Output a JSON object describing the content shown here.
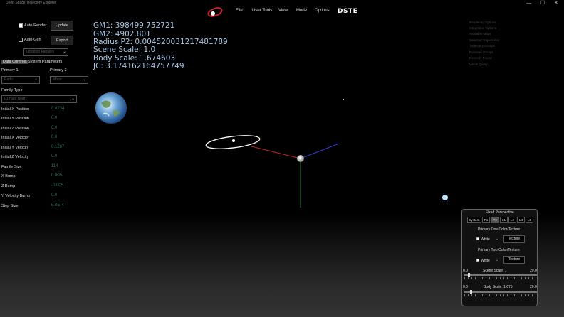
{
  "window": {
    "title": "Deep Space Trajectory Explorer",
    "minimize": "—",
    "maximize": "☐",
    "close": "✕"
  },
  "menu": {
    "items": [
      "File",
      "User Tools",
      "View",
      "Mode",
      "Options"
    ],
    "brand": "DSTE"
  },
  "left_panel": {
    "auto_render": {
      "label": "Auto-Render",
      "checked": true
    },
    "update_button": "Update",
    "auto_gen": {
      "label": "Auto-Gen",
      "checked": false
    },
    "export_button": "Export",
    "libration_select": "Libration Families",
    "tabs": [
      "Data Controls",
      "System Parameters"
    ],
    "primary1": {
      "label": "Primary 1",
      "value": "Earth"
    },
    "primary2": {
      "label": "Primary 2",
      "value": "Moon"
    },
    "family_type": {
      "label": "Family Type",
      "value": "L1 Halo North"
    },
    "fields": [
      {
        "label": "Initial X Position",
        "value": "0.8234"
      },
      {
        "label": "Initial Y Position",
        "value": "0.0"
      },
      {
        "label": "Initial Z Position",
        "value": "0.0"
      },
      {
        "label": "Initial X Velocity",
        "value": "0.0"
      },
      {
        "label": "Initial Y Velocity",
        "value": "0.1267"
      },
      {
        "label": "Initial Z Velocity",
        "value": "0.0"
      },
      {
        "label": "Family Size",
        "value": "114"
      },
      {
        "label": "X Bump",
        "value": "0.005"
      },
      {
        "label": "Z Bump",
        "value": "-0.005"
      },
      {
        "label": "Y Velocity Bump",
        "value": "0.0"
      },
      {
        "label": "Step Size",
        "value": "5.0E-4"
      }
    ]
  },
  "info": {
    "gm1": "GM1: 398499.752721",
    "gm2": "GM2: 4902.801",
    "radius_p2": "Radius P2: 0.004520031217481789",
    "scene_scale": "Scene Scale: 1.0",
    "body_scale": "Body Scale: 1.674603",
    "jc": "JC: 3.174162164757749"
  },
  "right_links": [
    "Rendering Options",
    "Integration Options",
    "Available Maps",
    "Selected Trajectories",
    "Trajectory Groups",
    "Poincare Groups",
    "Recently Found",
    "Visual Query"
  ],
  "perspective_panel": {
    "title": "Fixed Perspective",
    "buttons": [
      "System",
      "P1",
      "P2",
      "L1",
      "L2",
      "L4",
      "L5"
    ],
    "active_button": "P2",
    "primary_one_title": "Primary One Color/Texture",
    "primary_one_color": "White",
    "primary_one_texture": "Texture",
    "primary_two_title": "Primary Two Color/Texture",
    "primary_two_color": "White",
    "primary_two_texture": "Texture",
    "scene_scale_label": "Scene Scale: 1",
    "scene_min": "0.0",
    "scene_max": "20.0",
    "scene_value": 1,
    "body_scale_label": "Body Scale: 1.675",
    "body_min": "0.0",
    "body_max": "20.0",
    "body_value": 1.675
  },
  "colors": {
    "info_text": "#a9c8e6",
    "value_text": "#2f6f55",
    "axis_x": "#c0262c",
    "axis_y": "#1d7d2e",
    "axis_z": "#2a3fd0"
  }
}
